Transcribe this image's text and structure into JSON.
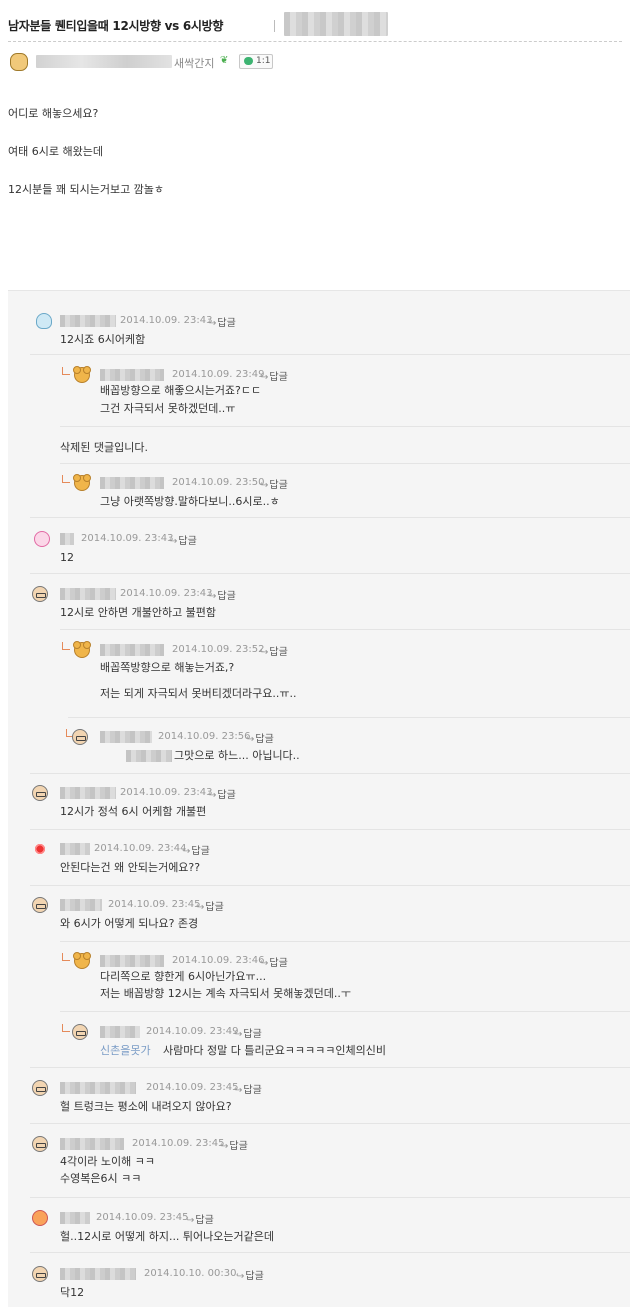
{
  "post": {
    "title": "남자분들 퀜티입을때 12시방향 vs 6시방향",
    "author_level": "새싹간지",
    "comment_badge": "1:1",
    "body": [
      "어디로 해놓으세요?",
      "여태 6시로 해왔는데",
      "12시분들 꽤 되시는거보고 깜놀ㅎ"
    ]
  },
  "reply_label": "답글",
  "comments": [
    {
      "icon": "bulb-icon",
      "date": "2014.10.09. 23:43",
      "text": [
        "12시죠 6시어케함"
      ]
    },
    {
      "icon": "bear-icon",
      "date": "2014.10.09. 23:49",
      "text": [
        "배꼽방향으로 해좋으시는거죠?ㄷㄷ",
        "그건 자극되서 못하겠던데..ㅠ"
      ]
    },
    {
      "deleted": "삭제된 댓글입니다."
    },
    {
      "icon": "bear-icon",
      "date": "2014.10.09. 23:50",
      "text": [
        "그냥 아랫쪽방향.말하다보니..6시로..ㅎ"
      ]
    },
    {
      "icon": "bunny-icon",
      "date": "2014.10.09. 23:43",
      "text": [
        "12"
      ]
    },
    {
      "icon": "grandpa-icon",
      "date": "2014.10.09. 23:43",
      "text": [
        "12시로 안하면 개불안하고 불편함"
      ]
    },
    {
      "icon": "bear-icon",
      "date": "2014.10.09. 23:52",
      "text": [
        "배꼽쪽방향으로 해놓는거죠,?",
        "",
        "저는 되게 자극되서 못버티겠더라구요..ㅠ.."
      ]
    },
    {
      "icon": "grandpa-icon",
      "date": "2014.10.09. 23:56",
      "text": [
        "그맛으로 하느... 아닙니다.."
      ]
    },
    {
      "icon": "grandpa-icon",
      "date": "2014.10.09. 23:43",
      "text": [
        "12시가 정석 6시 어케함 개불편"
      ]
    },
    {
      "icon": "spark-icon",
      "date": "2014.10.09. 23:44",
      "text": [
        "안된다는건 왜 안되는거에요??"
      ]
    },
    {
      "icon": "grandpa-icon",
      "date": "2014.10.09. 23:45",
      "text": [
        "와 6시가 어떻게 되나요? 존경"
      ]
    },
    {
      "icon": "bear-icon",
      "date": "2014.10.09. 23:46",
      "text": [
        "다리쪽으로 향한게 6시아닌가요ㅠ...",
        "저는 배꼽방향 12시는 계속 자극되서 못해놓겠던데..ㅜ"
      ]
    },
    {
      "icon": "grandpa-icon",
      "date": "2014.10.09. 23:49",
      "mention": "신촌을못가",
      "text": [
        "사람마다 정말 다 틀리군요ㅋㅋㅋㅋㅋ인체의신비"
      ]
    },
    {
      "icon": "grandpa-icon",
      "date": "2014.10.09. 23:45",
      "text": [
        "헐 트렁크는 평소에 내려오지 않아요?"
      ]
    },
    {
      "icon": "grandpa-icon",
      "date": "2014.10.09. 23:45",
      "text": [
        "4각이라 노이해 ㅋㅋ",
        "수영복은6시 ㅋㅋ"
      ]
    },
    {
      "icon": "fire-icon",
      "date": "2014.10.09. 23:45",
      "text": [
        "헐..12시로 어떻게 하지... 튀어나오는거같은데"
      ]
    },
    {
      "icon": "grandpa-icon",
      "date": "2014.10.10. 00:30",
      "text": [
        "닥12"
      ]
    }
  ]
}
